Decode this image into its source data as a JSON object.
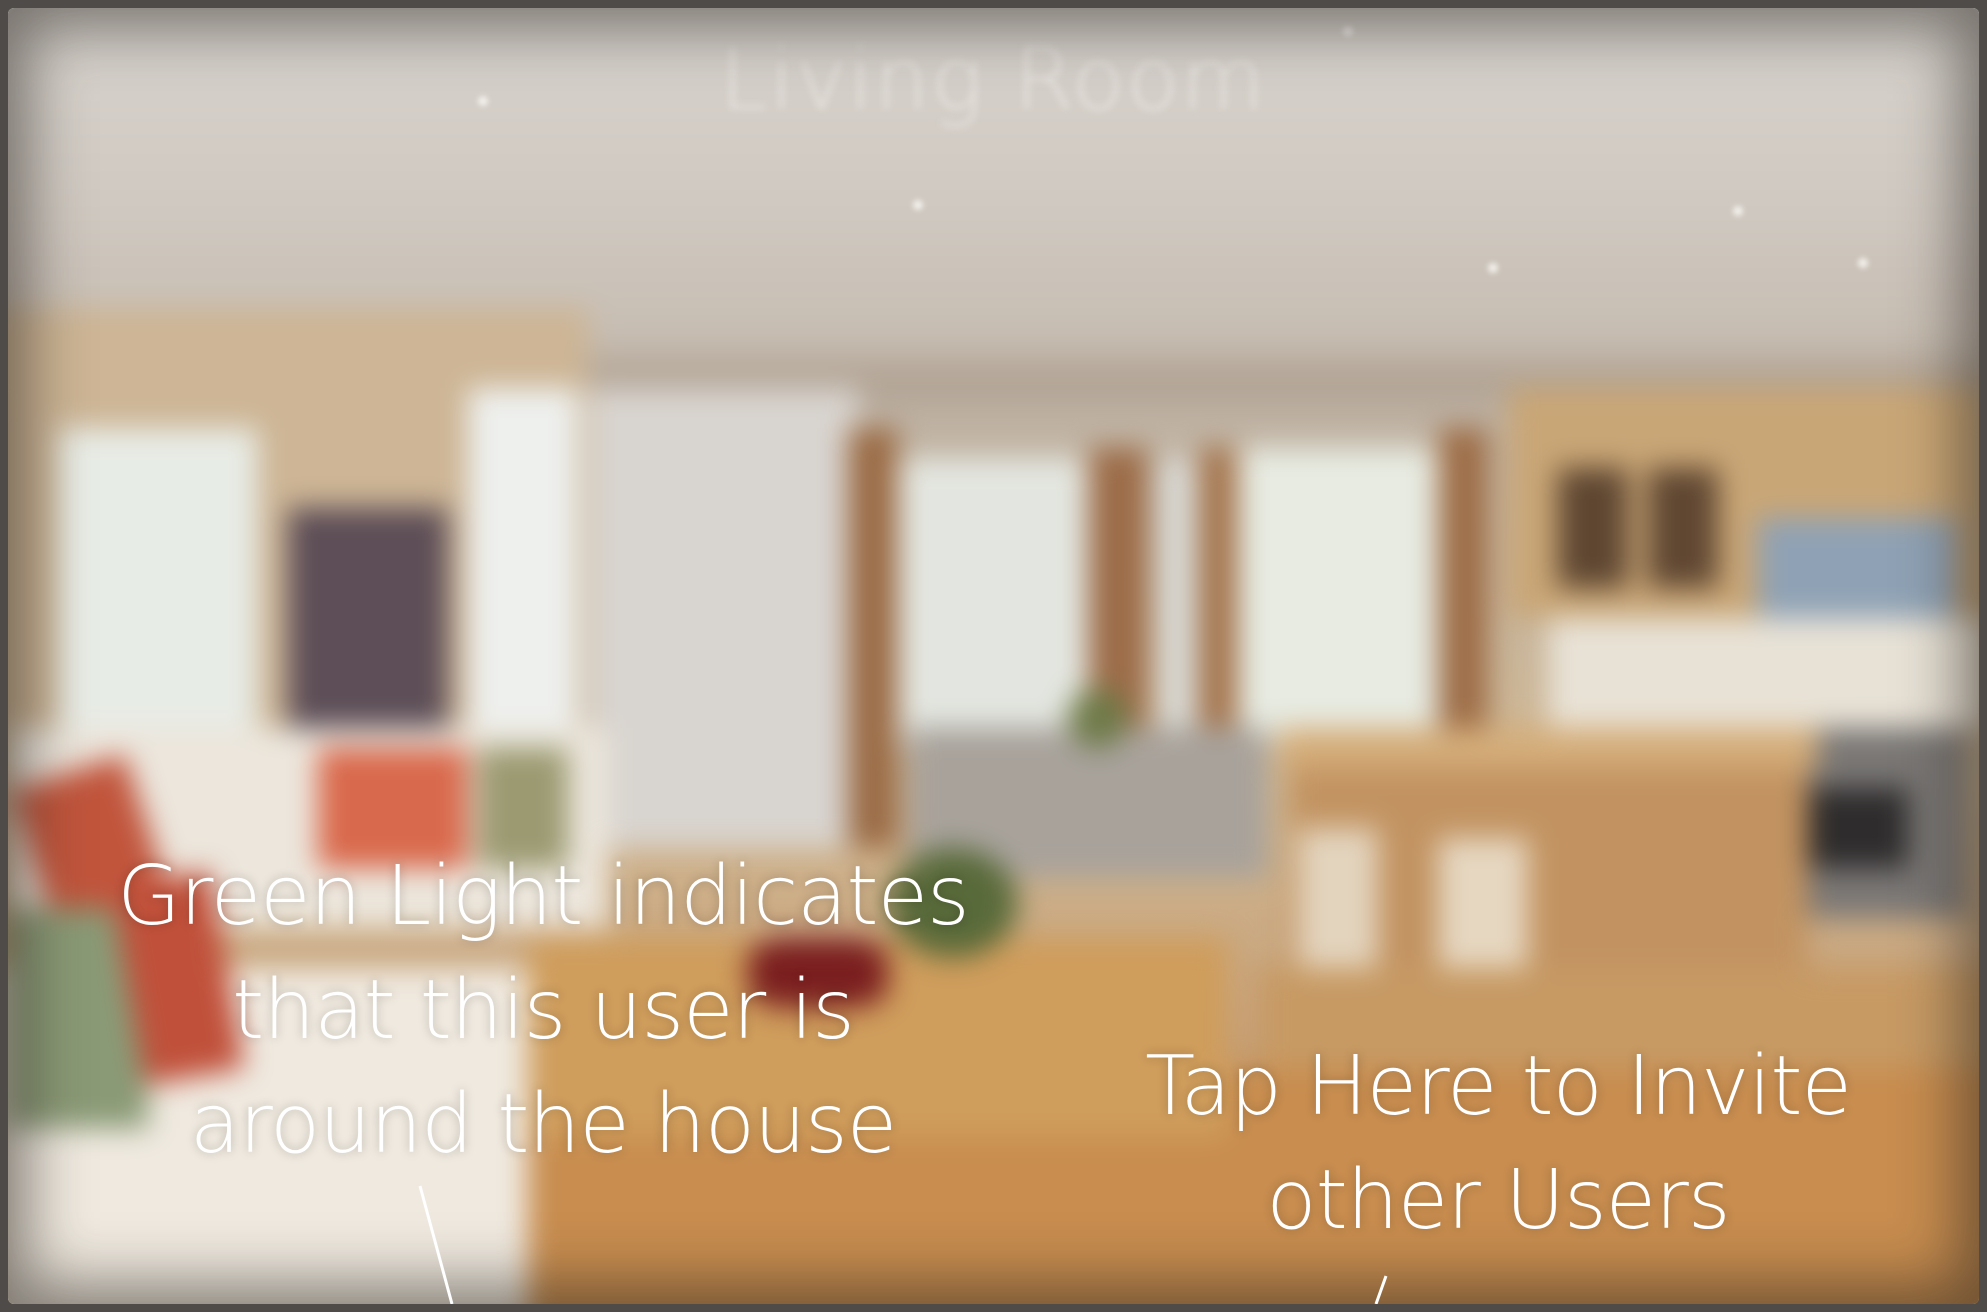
{
  "screen": {
    "room_title": "Living Room",
    "background_description_icon": "living-room-photo"
  },
  "callouts": {
    "presence": {
      "lines": [
        "Green Light indicates",
        "that this user is",
        "around the house"
      ]
    },
    "invite": {
      "lines": [
        "Tap Here to Invite",
        "other Users"
      ]
    }
  },
  "colors": {
    "callout_text": "#ffffff",
    "frame": "#4e4b48"
  }
}
